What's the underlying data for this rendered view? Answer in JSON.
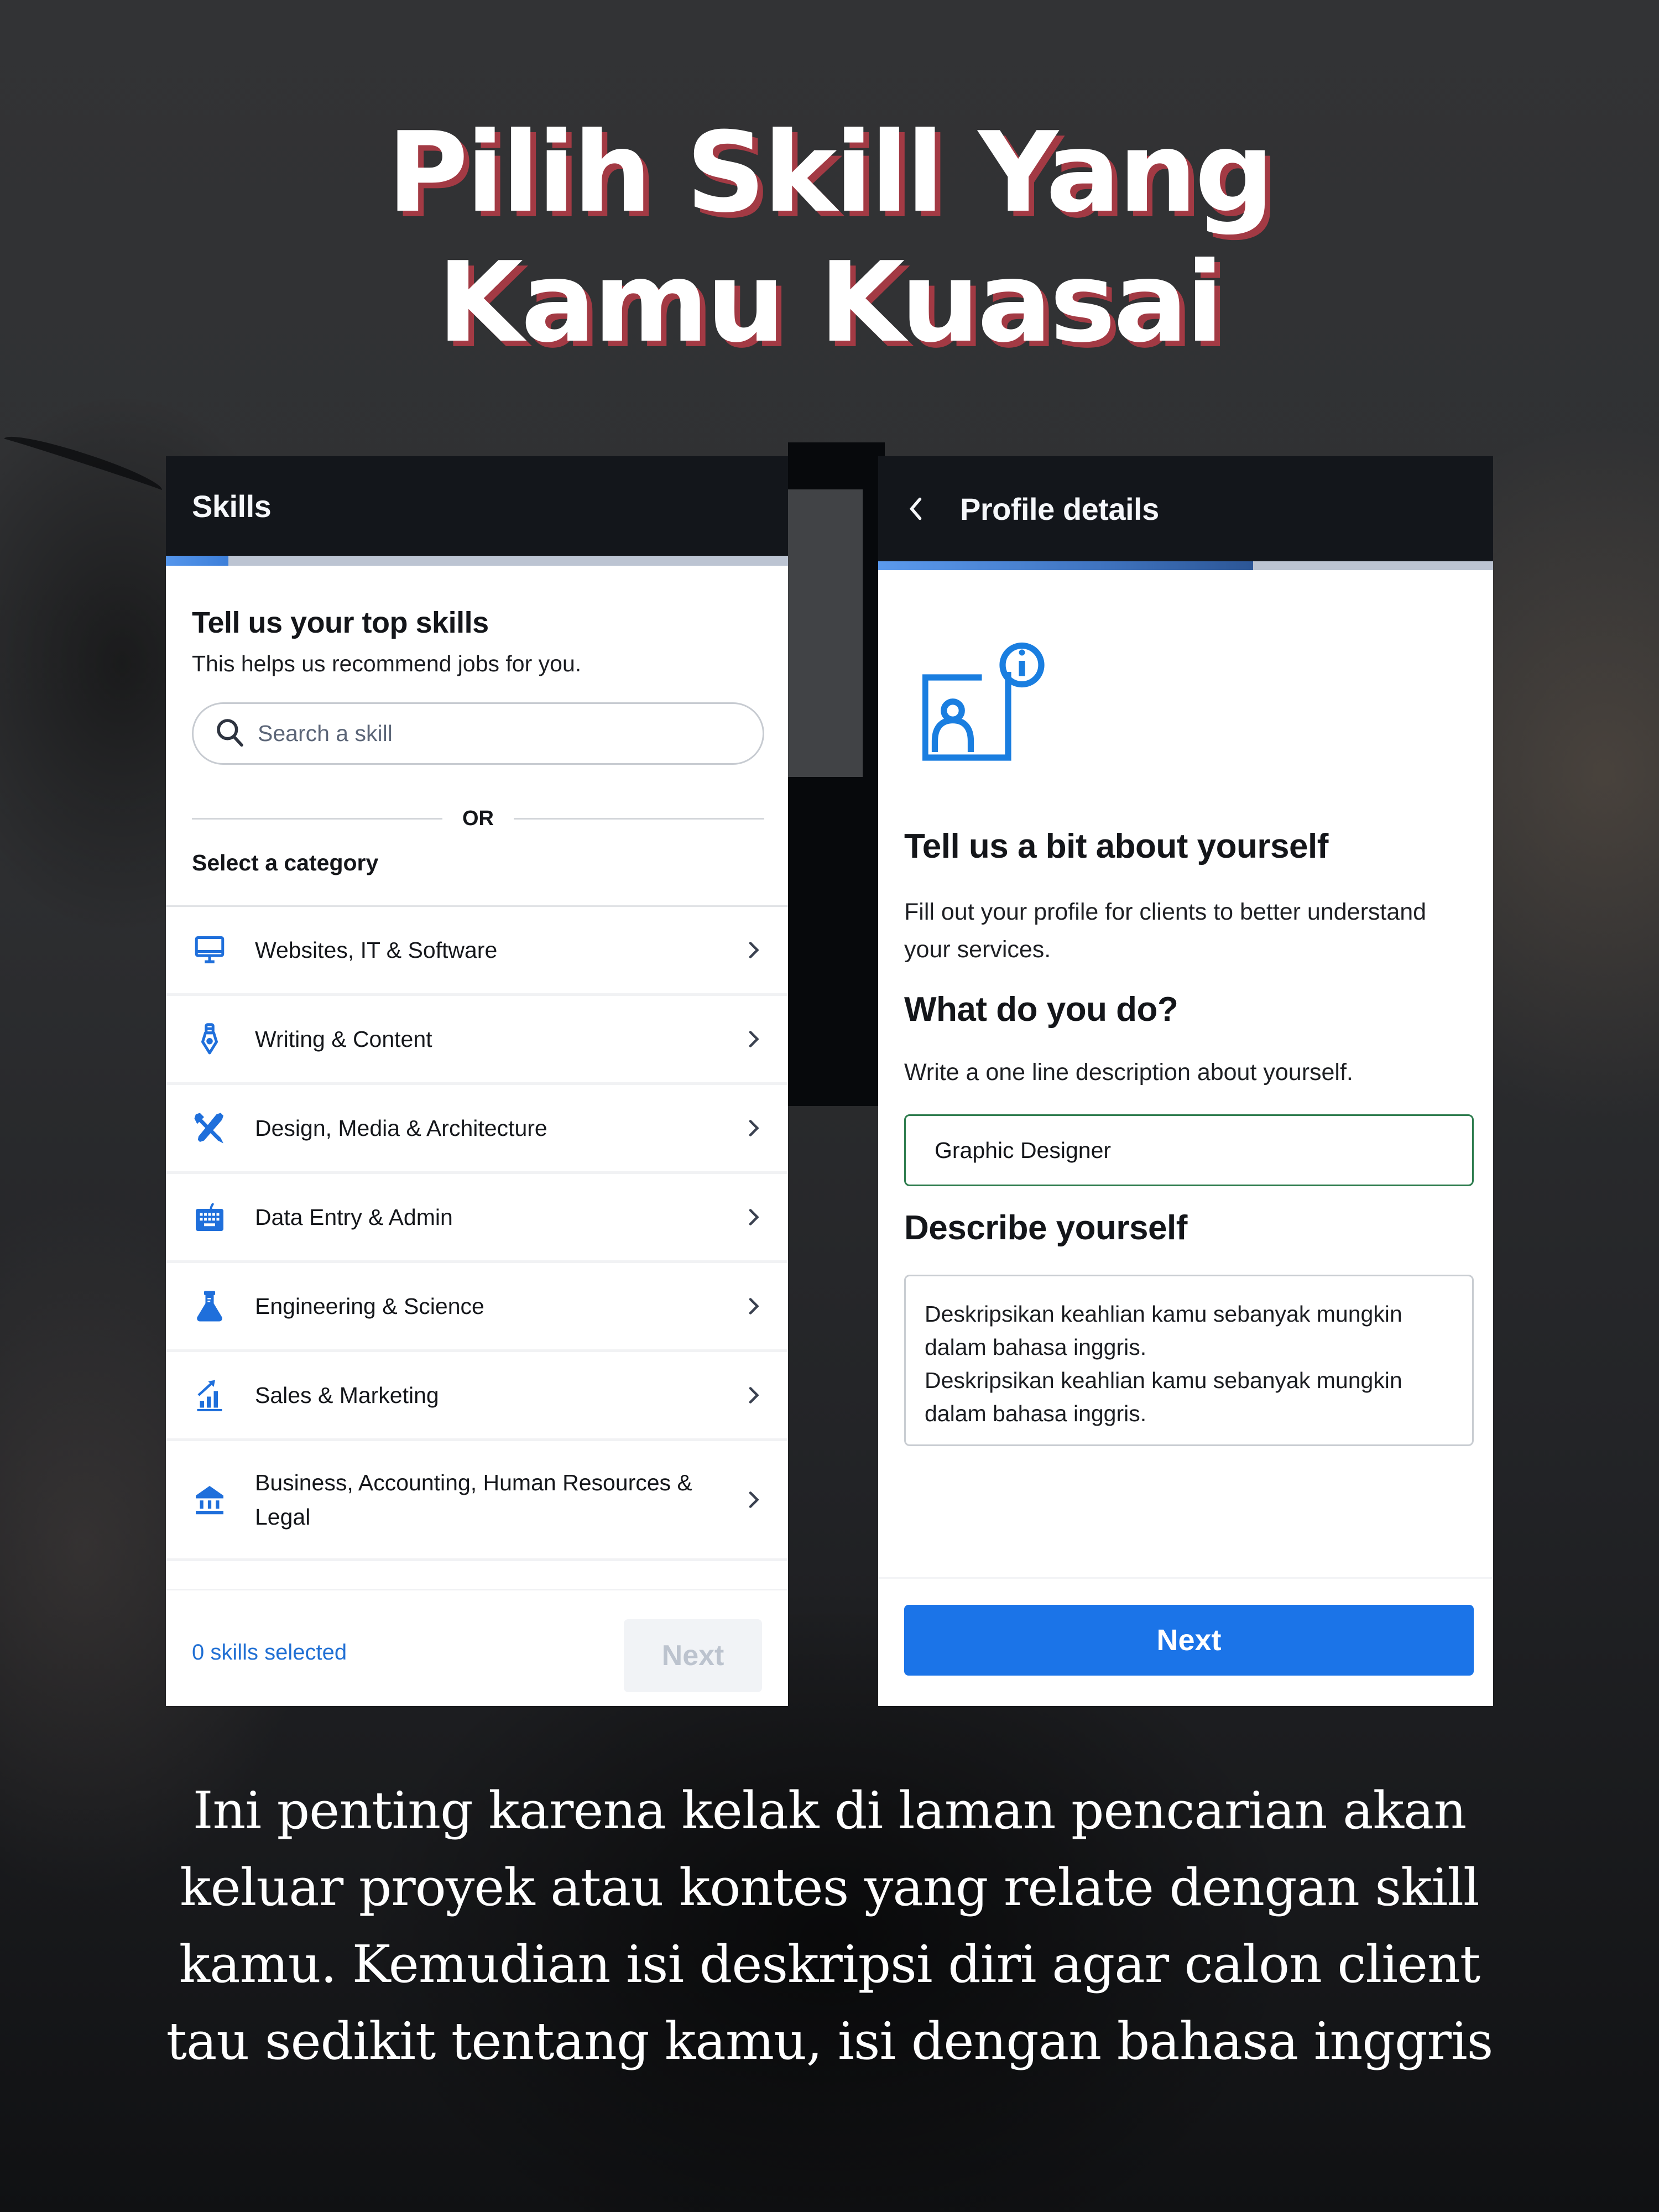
{
  "headline": {
    "line1": "Pilih Skill Yang",
    "line2": "Kamu Kuasai"
  },
  "colors": {
    "accent_blue": "#1b74e8",
    "header_dark": "#13161b",
    "title_shadow": "#a33a44",
    "input_focus_border": "#2f7d4f",
    "skills_count_text": "#2170d4"
  },
  "skills_screen": {
    "header_title": "Skills",
    "progress_fraction": 0.1,
    "heading": "Tell us your top skills",
    "subheading": "This helps us recommend jobs for you.",
    "search": {
      "icon": "search-icon",
      "placeholder": "Search a skill"
    },
    "divider_label": "OR",
    "category_label": "Select a category",
    "categories": [
      {
        "label": "Websites, IT & Software",
        "icon": "monitor-icon"
      },
      {
        "label": "Writing & Content",
        "icon": "pen-nib-icon"
      },
      {
        "label": "Design, Media & Architecture",
        "icon": "design-tools-icon"
      },
      {
        "label": "Data Entry & Admin",
        "icon": "keyboard-icon"
      },
      {
        "label": "Engineering & Science",
        "icon": "flask-icon"
      },
      {
        "label": "Sales & Marketing",
        "icon": "chart-growth-icon"
      },
      {
        "label": "Business, Accounting, Human Resources & Legal",
        "icon": "bank-icon"
      }
    ],
    "footer": {
      "skills_selected": "0 skills selected",
      "next_label": "Next",
      "next_enabled": false
    }
  },
  "profile_screen": {
    "header_title": "Profile details",
    "back_icon": "chevron-left-icon",
    "progress_fraction": 0.61,
    "illustration_icon": "profile-info-icon",
    "heading": "Tell us a bit about yourself",
    "intro": "Fill out your profile for clients to better understand your services.",
    "what_heading": "What do you do?",
    "what_hint": "Write a one line description about yourself.",
    "what_value": "Graphic Designer",
    "describe_heading": "Describe yourself",
    "describe_value": "Deskripsikan keahlian kamu sebanyak mungkin dalam bahasa inggris.\nDeskripsikan keahlian kamu sebanyak mungkin dalam bahasa inggris.",
    "next_label": "Next"
  },
  "caption": {
    "lines": [
      "Ini penting karena kelak di laman pencarian akan",
      "keluar proyek atau kontes yang relate dengan skill",
      "kamu. Kemudian isi deskripsi diri agar calon client",
      "tau sedikit tentang kamu, isi dengan bahasa inggris"
    ]
  }
}
